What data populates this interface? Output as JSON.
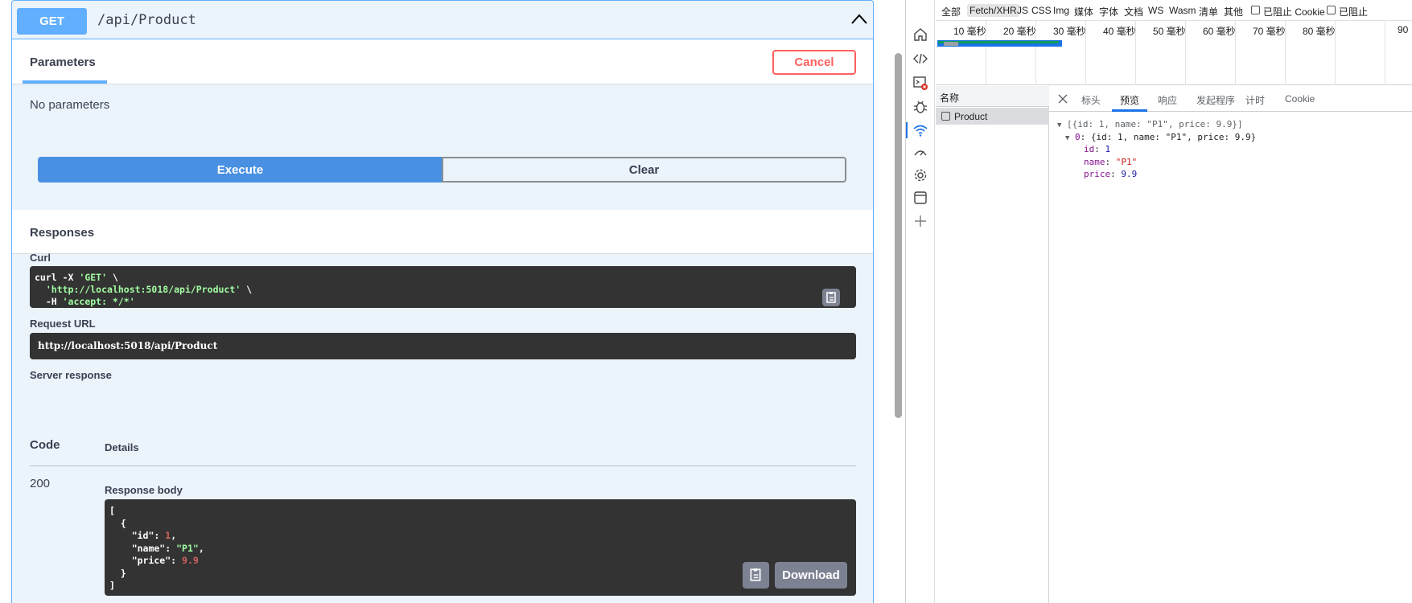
{
  "swagger": {
    "method": "GET",
    "path": "/api/Product",
    "parameters_tab": "Parameters",
    "cancel_label": "Cancel",
    "no_parameters": "No parameters",
    "execute_label": "Execute",
    "clear_label": "Clear",
    "responses_title": "Responses",
    "curl_label": "Curl",
    "curl_lines": {
      "l1_cmd": "curl -X ",
      "l1_method": "'GET'",
      "l1_tail": " \\",
      "l2_url": "'http://localhost:5018/api/Product'",
      "l2_tail": " \\",
      "l3_flag": "  -H ",
      "l3_header": "'accept: */*'"
    },
    "request_url_label": "Request URL",
    "request_url": "http://localhost:5018/api/Product",
    "server_response_label": "Server response",
    "code_header": "Code",
    "details_header": "Details",
    "status_code": "200",
    "response_body_label": "Response body",
    "response_body": {
      "open": "[",
      "obj_open": "  {",
      "id_key": "    \"id\"",
      "id_val": "1",
      "name_key": "    \"name\"",
      "name_val": "\"P1\"",
      "price_key": "    \"price\"",
      "price_val": "9.9",
      "obj_close": "  }",
      "close": "]"
    },
    "download_label": "Download"
  },
  "devtools": {
    "filters": {
      "all": "全部",
      "fetch_xhr": "Fetch/XHR",
      "js": "JS",
      "css": "CSS",
      "img": "Img",
      "media": "媒体",
      "font": "字体",
      "doc": "文档",
      "ws": "WS",
      "wasm": "Wasm",
      "manifest": "清单",
      "other": "其他",
      "blocked_cookies": "已阻止 Cookie",
      "blocked_requests": "已阻止"
    },
    "timeline_ticks": [
      "10 毫秒",
      "20 毫秒",
      "30 毫秒",
      "40 毫秒",
      "50 毫秒",
      "60 毫秒",
      "70 毫秒",
      "80 毫秒",
      "90"
    ],
    "name_column": "名称",
    "request_name": "Product",
    "detail_tabs": {
      "headers": "标头",
      "preview": "预览",
      "response": "响应",
      "initiator": "发起程序",
      "timing": "计时",
      "cookie": "Cookie"
    },
    "preview": {
      "root": "[{id: 1, name: \"P1\", price: 9.9}]",
      "item_index": "0",
      "item_summary": "{id: 1, name: \"P1\", price: 9.9}",
      "id_key": "id",
      "id_val": "1",
      "name_key": "name",
      "name_val": "\"P1\"",
      "price_key": "price",
      "price_val": "9.9"
    }
  }
}
